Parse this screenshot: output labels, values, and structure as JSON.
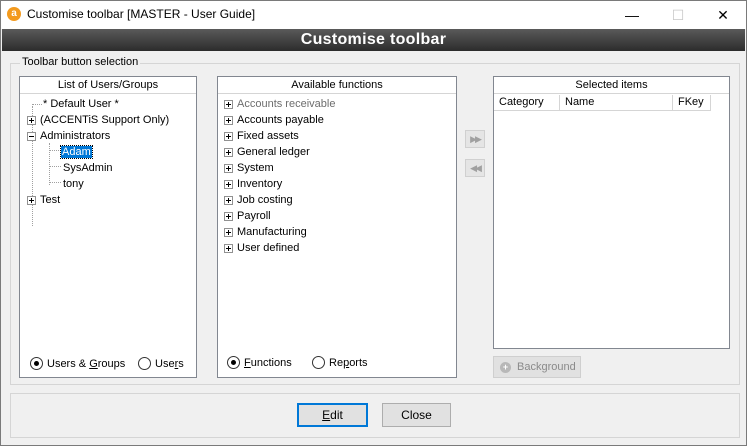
{
  "window": {
    "title": "Customise toolbar [MASTER - User Guide]",
    "icon_glyph": "a",
    "minimize_glyph": "—",
    "maximize_glyph": "☐",
    "close_glyph": "✕"
  },
  "banner": {
    "title": "Customise toolbar"
  },
  "group": {
    "label": "Toolbar button selection"
  },
  "users_panel": {
    "header": "List of Users/Groups",
    "items": [
      {
        "label": "* Default User *"
      },
      {
        "label": "(ACCENTiS Support Only)"
      },
      {
        "label": "Administrators"
      },
      {
        "label": "Adam"
      },
      {
        "label": "SysAdmin"
      },
      {
        "label": "tony"
      },
      {
        "label": "Test"
      }
    ],
    "radio_users_groups": {
      "pre": "Users & ",
      "u": "G",
      "post": "roups"
    },
    "radio_users": {
      "pre": "Use",
      "u": "r",
      "post": "s"
    }
  },
  "functions_panel": {
    "header": "Available functions",
    "items": [
      {
        "label": "Accounts receivable"
      },
      {
        "label": "Accounts payable"
      },
      {
        "label": "Fixed assets"
      },
      {
        "label": "General ledger"
      },
      {
        "label": "System"
      },
      {
        "label": "Inventory"
      },
      {
        "label": "Job costing"
      },
      {
        "label": "Payroll"
      },
      {
        "label": "Manufacturing"
      },
      {
        "label": "User defined"
      }
    ],
    "radio_functions": {
      "u": "F",
      "post": "unctions"
    },
    "radio_reports": {
      "pre": "Re",
      "u": "p",
      "post": "orts"
    }
  },
  "transfer": {
    "add_glyph": "▶▶",
    "remove_glyph": "◀◀"
  },
  "selected_panel": {
    "header": "Selected items",
    "columns": [
      "Category",
      "Name",
      "FKey"
    ]
  },
  "background_button": {
    "label": "Background",
    "icon_glyph": "+"
  },
  "buttons": {
    "edit_u": "E",
    "edit_rest": "dit",
    "close": "Close"
  },
  "colors": {
    "selection": "#0078d7",
    "banner_top": "#5a5a5a",
    "banner_bottom": "#2c2c2c",
    "app_icon": "#f39a1e"
  }
}
